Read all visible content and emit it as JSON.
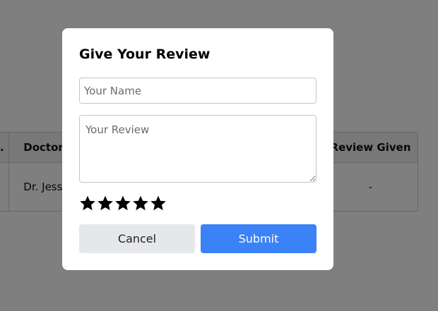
{
  "background_table": {
    "headers": {
      "sno": ".",
      "doctor": "Doctor",
      "review_given": "Review Given"
    },
    "row": {
      "doctor": "Dr. Jessic",
      "review_given": "-"
    }
  },
  "modal": {
    "title": "Give Your Review",
    "name_placeholder": "Your Name",
    "name_value": "",
    "review_placeholder": "Your Review",
    "review_value": "",
    "rating": {
      "stars_total": 5,
      "stars_filled": 5,
      "icon": "star-icon"
    },
    "cancel_label": "Cancel",
    "submit_label": "Submit"
  },
  "colors": {
    "overlay": "rgba(0,0,0,0.5)",
    "submit_button": "#3b82f6",
    "cancel_button": "#e5e7eb",
    "star": "#000000"
  }
}
